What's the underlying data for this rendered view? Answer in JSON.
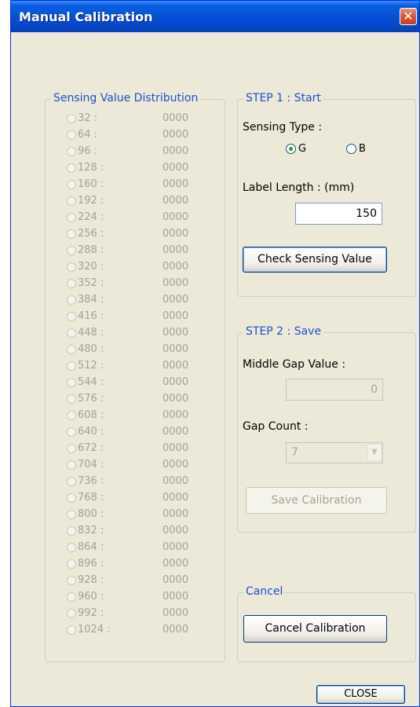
{
  "window": {
    "title": "Manual Calibration",
    "close_icon": "✕"
  },
  "distribution": {
    "title": "Sensing Value Distribution",
    "rows": [
      {
        "key": "32 :",
        "value": "0000"
      },
      {
        "key": "64 :",
        "value": "0000"
      },
      {
        "key": "96 :",
        "value": "0000"
      },
      {
        "key": "128 :",
        "value": "0000"
      },
      {
        "key": "160 :",
        "value": "0000"
      },
      {
        "key": "192 :",
        "value": "0000"
      },
      {
        "key": "224 :",
        "value": "0000"
      },
      {
        "key": "256 :",
        "value": "0000"
      },
      {
        "key": "288 :",
        "value": "0000"
      },
      {
        "key": "320 :",
        "value": "0000"
      },
      {
        "key": "352 :",
        "value": "0000"
      },
      {
        "key": "384 :",
        "value": "0000"
      },
      {
        "key": "416 :",
        "value": "0000"
      },
      {
        "key": "448 :",
        "value": "0000"
      },
      {
        "key": "480 :",
        "value": "0000"
      },
      {
        "key": "512 :",
        "value": "0000"
      },
      {
        "key": "544 :",
        "value": "0000"
      },
      {
        "key": "576 :",
        "value": "0000"
      },
      {
        "key": "608 :",
        "value": "0000"
      },
      {
        "key": "640 :",
        "value": "0000"
      },
      {
        "key": "672 :",
        "value": "0000"
      },
      {
        "key": "704 :",
        "value": "0000"
      },
      {
        "key": "736 :",
        "value": "0000"
      },
      {
        "key": "768 :",
        "value": "0000"
      },
      {
        "key": "800 :",
        "value": "0000"
      },
      {
        "key": "832 :",
        "value": "0000"
      },
      {
        "key": "864 :",
        "value": "0000"
      },
      {
        "key": "896 :",
        "value": "0000"
      },
      {
        "key": "928 :",
        "value": "0000"
      },
      {
        "key": "960 :",
        "value": "0000"
      },
      {
        "key": "992 :",
        "value": "0000"
      },
      {
        "key": "1024 :",
        "value": "0000"
      }
    ]
  },
  "step1": {
    "title": "STEP 1 : Start",
    "sensing_type_label": "Sensing Type :",
    "option_g": "G",
    "option_b": "B",
    "selected": "G",
    "label_length_label": "Label Length : (mm)",
    "label_length_value": "150",
    "check_button": "Check Sensing Value"
  },
  "step2": {
    "title": "STEP 2 : Save",
    "middle_gap_label": "Middle Gap Value :",
    "middle_gap_value": "0",
    "gap_count_label": "Gap Count :",
    "gap_count_value": "7",
    "save_button": "Save Calibration"
  },
  "cancel": {
    "title": "Cancel",
    "cancel_button": "Cancel Calibration"
  },
  "footer": {
    "close_button": "CLOSE"
  }
}
